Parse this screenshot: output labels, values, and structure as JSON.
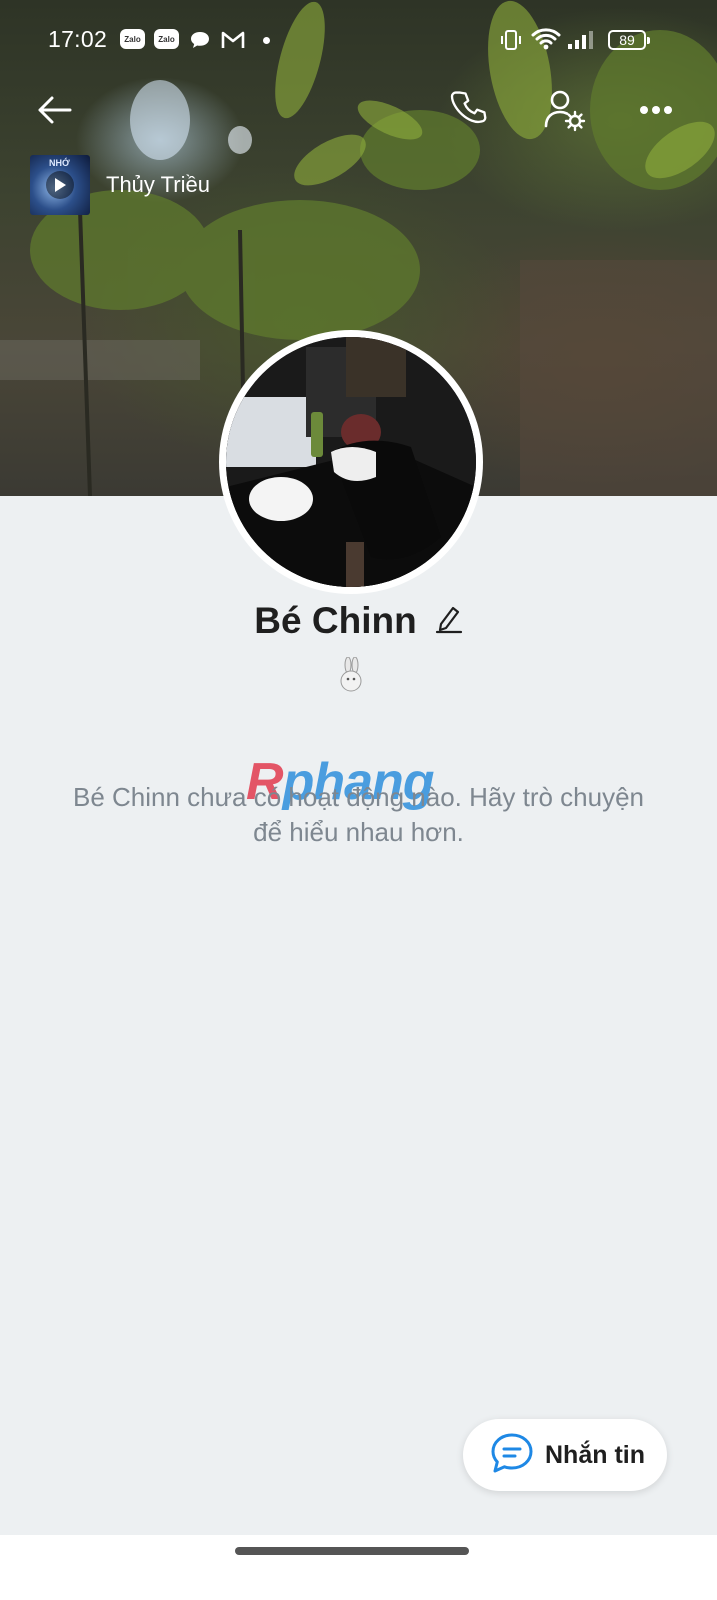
{
  "status_bar": {
    "time": "17:02",
    "notification_icons": [
      "zalo-icon",
      "zalo-icon",
      "chat-bubble-icon",
      "gmail-icon",
      "dot-icon"
    ],
    "zalo_label": "Zalo",
    "battery": "89"
  },
  "header": {
    "actions": [
      "back-arrow-icon",
      "phone-icon",
      "user-settings-icon",
      "more-icon"
    ]
  },
  "music": {
    "title": "Thủy Triều",
    "cover_text": "NHỚ"
  },
  "profile": {
    "name": "Bé Chinn",
    "status_emoji": "🐇"
  },
  "empty_state": {
    "message": "Bé Chinn chưa có hoạt động nào. Hãy trò chuyện để hiểu nhau hơn."
  },
  "watermark": {
    "first": "R",
    "rest": "phang"
  },
  "fab": {
    "label": "Nhắn tin"
  },
  "colors": {
    "background": "#edf0f2",
    "fab_icon": "#1e88e5",
    "empty_text": "#7e8790"
  }
}
